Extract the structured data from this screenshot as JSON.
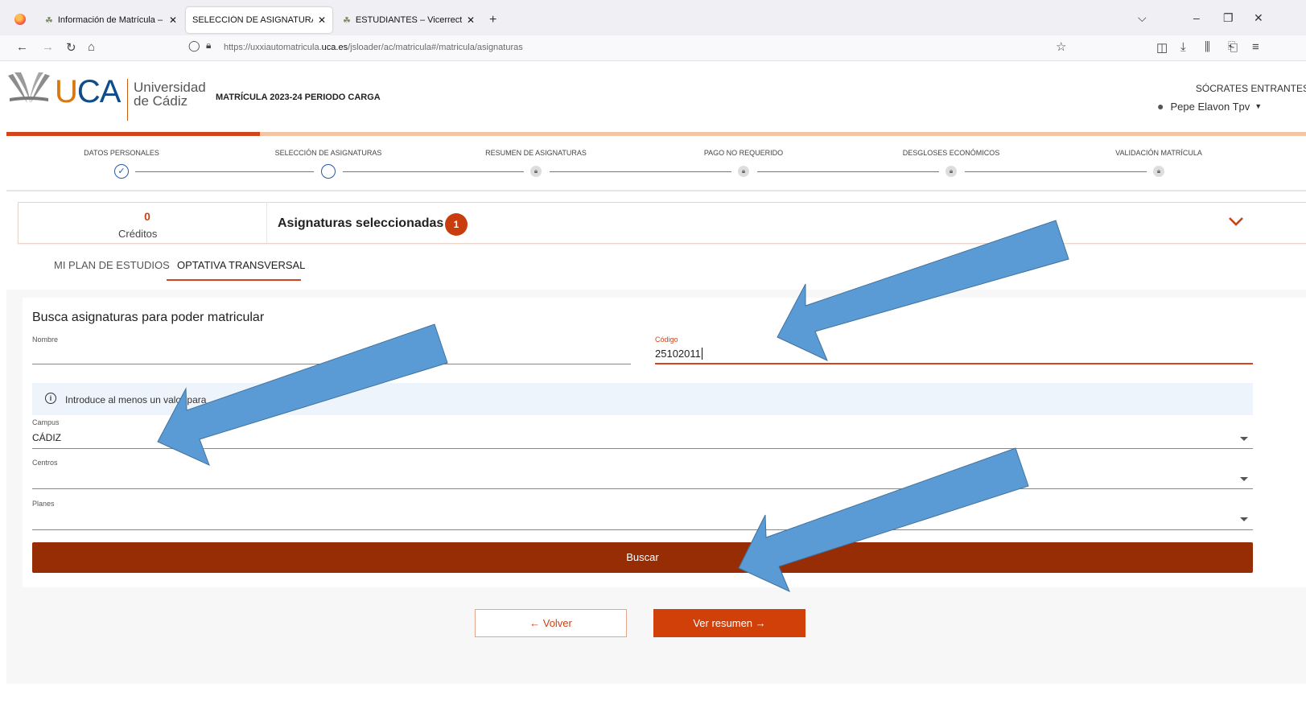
{
  "browser": {
    "tabs": [
      {
        "title": "Información de Matrícula – Áre",
        "active": false
      },
      {
        "title": "SELECCIÓN DE ASIGNATURAS - Uni",
        "active": true
      },
      {
        "title": "ESTUDIANTES – Vicerrectorado",
        "active": false
      }
    ],
    "new_tab": "+",
    "url_prefix": "https://uxxiautomatricula.",
    "url_domain": "uca.es",
    "url_suffix": "/jsloader/ac/matricula#/matricula/asignaturas"
  },
  "header": {
    "logo_letters_u": "U",
    "logo_letters_ca": "CA",
    "logo_line1": "Universidad",
    "logo_line2": "de Cádiz",
    "app_title": "MATRÍCULA 2023-24 PERIODO CARGA",
    "role": "SÓCRATES ENTRANTES",
    "user": "Pepe Elavon Tpv"
  },
  "steps": [
    {
      "label": "DATOS PERSONALES",
      "state": "done"
    },
    {
      "label": "SELECCIÓN DE ASIGNATURAS",
      "state": "current"
    },
    {
      "label": "RESUMEN DE ASIGNATURAS",
      "state": "locked"
    },
    {
      "label": "PAGO NO REQUERIDO",
      "state": "locked"
    },
    {
      "label": "DESGLOSES ECONÓMICOS",
      "state": "locked"
    },
    {
      "label": "VALIDACIÓN MATRÍCULA",
      "state": "locked"
    }
  ],
  "summary": {
    "credits_value": "0",
    "credits_label": "Créditos",
    "selected_title": "Asignaturas seleccionadas",
    "selected_count": "1"
  },
  "tabs": {
    "plan": "MI PLAN DE ESTUDIOS",
    "optativa": "OPTATIVA TRANSVERSAL"
  },
  "search": {
    "title": "Busca asignaturas para poder matricular",
    "nombre_label": "Nombre",
    "nombre_value": "",
    "codigo_label": "Código",
    "codigo_value": "25102011",
    "info_text": "Introduce al menos un valor para",
    "campus_label": "Campus",
    "campus_value": "CÁDIZ",
    "centros_label": "Centros",
    "centros_value": "",
    "planes_label": "Planes",
    "planes_value": "",
    "buscar": "Buscar"
  },
  "footer": {
    "volver": "Volver",
    "ver_resumen": "Ver resumen"
  },
  "colors": {
    "accent": "#d2451a",
    "buscar_bg": "#962d05",
    "annotation_arrow": "#5b9bd5"
  }
}
